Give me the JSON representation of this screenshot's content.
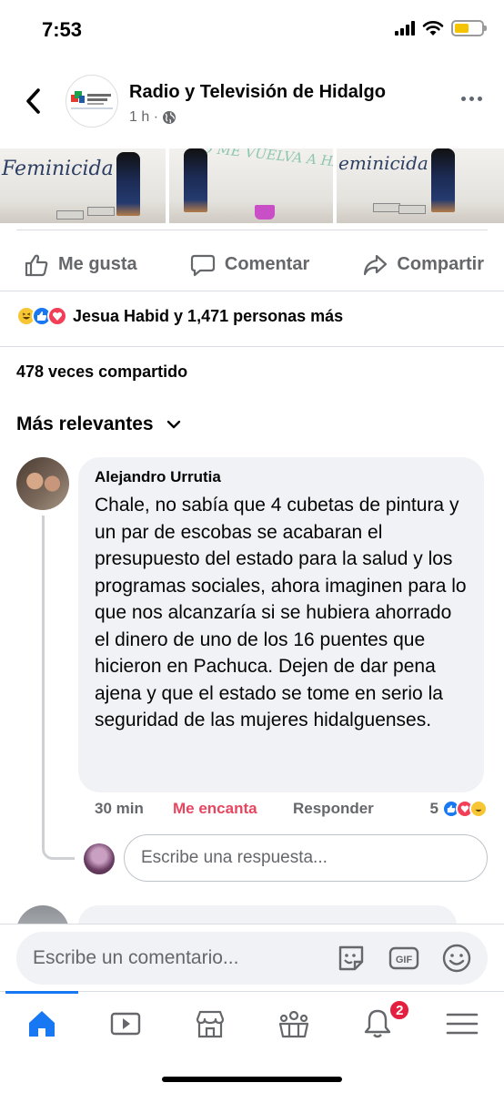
{
  "status_bar": {
    "time": "7:53"
  },
  "header": {
    "page_name": "Radio y Televisión de Hidalgo",
    "time_ago": "1 h ·"
  },
  "actions": {
    "like": "Me gusta",
    "comment": "Comentar",
    "share": "Compartir"
  },
  "reactions": {
    "summary": "Jesua Habid y 1,471 personas más"
  },
  "shares": {
    "text": "478 veces compartido"
  },
  "sort": {
    "label": "Más relevantes"
  },
  "comment": {
    "author": "Alejandro Urrutia",
    "text": "Chale, no sabía que 4 cubetas de pintura y un par de escobas se acabaran el presupuesto del estado para la salud y los programas sociales, ahora imaginen para lo que nos alcanzaría si se hubiera ahorrado el dinero de uno de los 16 puentes que hicieron en Pachuca. Dejen de dar pena ajena y que el estado se tome en serio la seguridad de las mujeres hidalguenses.",
    "time": "30 min",
    "love_label": "Me encanta",
    "reply_label": "Responder",
    "reaction_count": "5"
  },
  "reply": {
    "placeholder": "Escribe una respuesta..."
  },
  "composer": {
    "placeholder": "Escribe un comentario..."
  },
  "photos": [
    {
      "graffiti": "Feminicida"
    },
    {
      "graffiti": "NO ME VUELVA A HACER DAÑO"
    },
    {
      "graffiti": "eminicida"
    }
  ],
  "tabs": {
    "notifications_badge": "2",
    "items": [
      "home-icon",
      "video-icon",
      "marketplace-icon",
      "groups-icon",
      "bell-icon",
      "menu-icon"
    ]
  },
  "colors": {
    "accent": "#1877f2",
    "love": "#e8465f",
    "badge": "#e41e3f"
  }
}
